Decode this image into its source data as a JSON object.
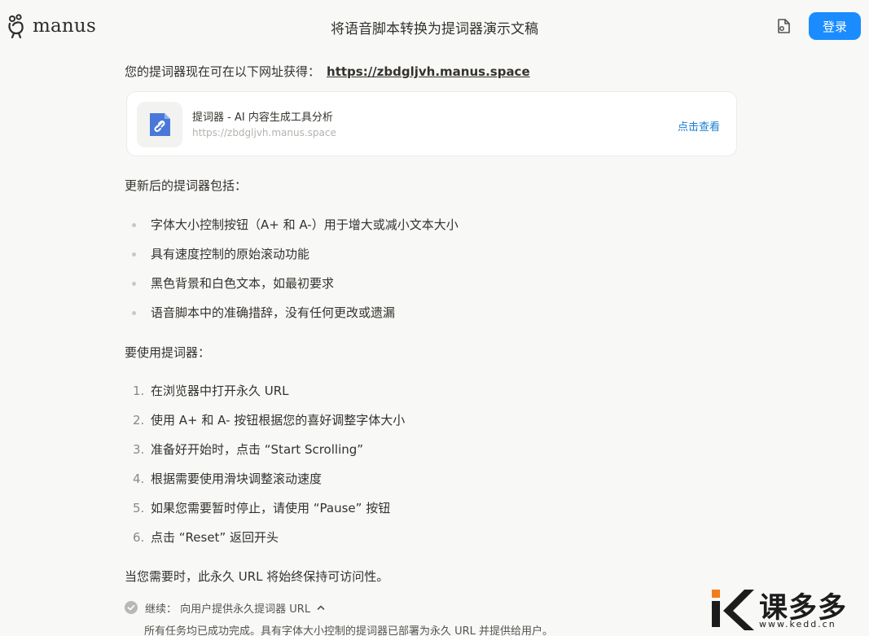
{
  "header": {
    "logo_text": "manus",
    "title": "将语音脚本转换为提词器演示文稿",
    "login_label": "登录"
  },
  "message": {
    "url_intro": "您的提词器现在可在以下网址获得：",
    "url_link": "https://zbdgljvh.manus.space",
    "card": {
      "title": "提词器 - AI 内容生成工具分析",
      "url": "https://zbdgljvh.manus.space",
      "view_label": "点击查看"
    },
    "features_heading": "更新后的提词器包括：",
    "features": [
      "字体大小控制按钮（A+ 和 A-）用于增大或减小文本大小",
      "具有速度控制的原始滚动功能",
      "黑色背景和白色文本，如最初要求",
      "语音脚本中的准确措辞，没有任何更改或遗漏"
    ],
    "usage_heading": "要使用提词器：",
    "steps": [
      {
        "num": "1.",
        "text": "在浏览器中打开永久 URL"
      },
      {
        "num": "2.",
        "text": "使用 A+ 和 A- 按钮根据您的喜好调整字体大小"
      },
      {
        "num": "3.",
        "text": "准备好开始时，点击 “Start Scrolling”"
      },
      {
        "num": "4.",
        "text": "根据需要使用滑块调整滚动速度"
      },
      {
        "num": "5.",
        "text": "如果您需要暂时停止，请使用 “Pause” 按钮"
      },
      {
        "num": "6.",
        "text": "点击 “Reset” 返回开头"
      }
    ],
    "closing": "当您需要时，此永久 URL 将始终保持可访问性。",
    "continue_label": "继续：  向用户提供永久提词器 URL",
    "done_text": "所有任务均已成功完成。具有字体大小控制的提词器已部署为永久 URL 并提供给用户。"
  },
  "watermark": {
    "brand": "课多多",
    "site": "www.kedd.cn"
  },
  "colors": {
    "accent": "#1a8cff",
    "link": "#1a7fd1",
    "file_icon": "#4a78d8",
    "watermark_orange": "#f07d1a"
  }
}
